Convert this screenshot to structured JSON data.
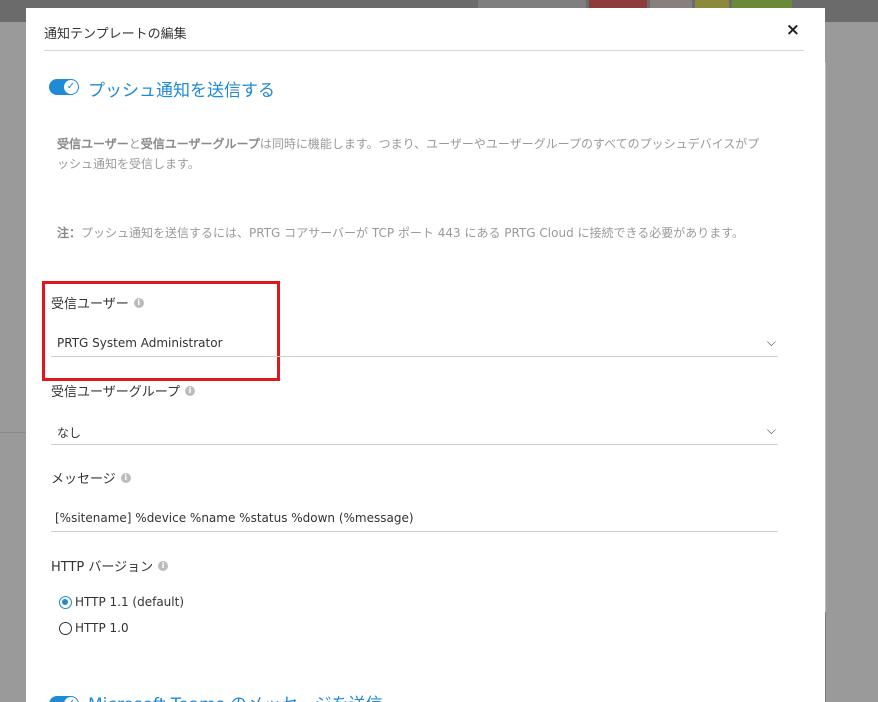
{
  "modal": {
    "title": "通知テンプレートの編集",
    "close": "×"
  },
  "push": {
    "toggle_label": "プッシュ通知を送信する",
    "info1_bold1": "受信ユーザー",
    "info1_mid": "と",
    "info1_bold2": "受信ユーザーグループ",
    "info1_rest": "は同時に機能します。つまり、ユーザーやユーザーグループのすべてのプッシュデバイスがプッシュ通知を受信します。",
    "note_bold": "注：",
    "note_rest": "プッシュ通知を送信するには、PRTG コアサーバーが TCP ポート 443 にある PRTG Cloud に接続できる必要があります。"
  },
  "fields": {
    "recipient_user": {
      "label": "受信ユーザー",
      "value": "PRTG System Administrator"
    },
    "recipient_group": {
      "label": "受信ユーザーグループ",
      "value": "なし"
    },
    "message": {
      "label": "メッセージ",
      "value": "[%sitename] %device %name %status %down (%message)"
    },
    "http_version": {
      "label": "HTTP バージョン",
      "options": [
        {
          "label": "HTTP 1.1 (default)",
          "selected": true
        },
        {
          "label": "HTTP 1.0",
          "selected": false
        }
      ]
    }
  },
  "teams": {
    "toggle_label": "Microsoft Teams のメッセージを送信"
  },
  "colors": {
    "accent": "#1f8ad6",
    "highlight": "#e0161e"
  },
  "icons": {
    "toggle_check": "✓",
    "info": "i",
    "chevron": "⌵"
  }
}
